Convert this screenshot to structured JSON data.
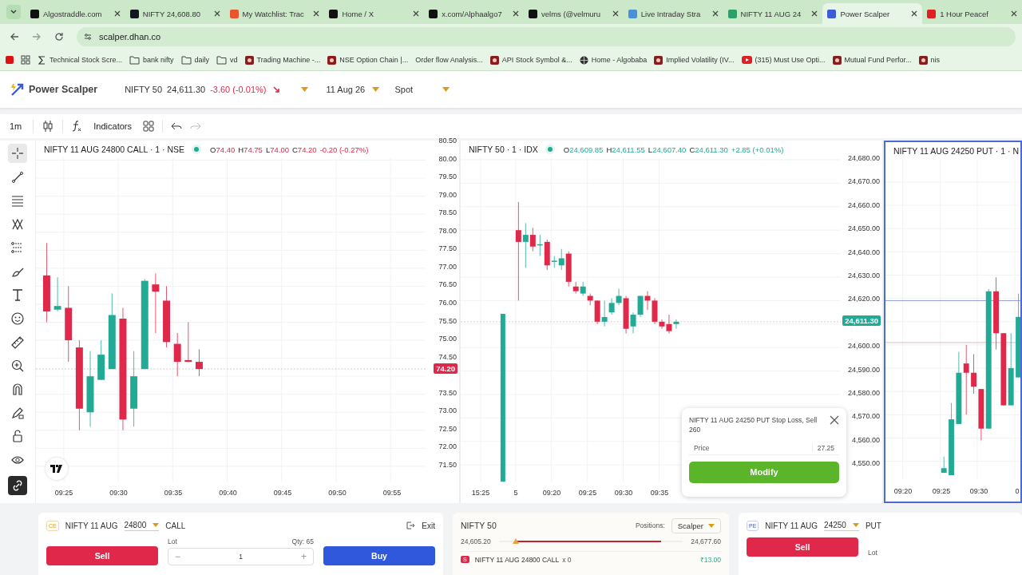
{
  "browser": {
    "tabs": [
      {
        "title": "Algostraddle.com",
        "color": "#111111",
        "selected": false
      },
      {
        "title": "NIFTY 24,608.80",
        "color": "#131722",
        "selected": false
      },
      {
        "title": "My Watchlist: Trac",
        "color": "#e8542f",
        "selected": false
      },
      {
        "title": "Home / X",
        "color": "#111111",
        "selected": false
      },
      {
        "title": "x.com/Alphaalgo7",
        "color": "#111111",
        "selected": false
      },
      {
        "title": "velms (@velmuru",
        "color": "#111111",
        "selected": false
      },
      {
        "title": "Live Intraday Stra",
        "color": "#4a90d9",
        "selected": false
      },
      {
        "title": "NIFTY 11 AUG 24",
        "color": "#2e9e6a",
        "selected": false
      },
      {
        "title": "Power Scalper",
        "color": "#3d5ad8",
        "selected": true
      },
      {
        "title": "1 Hour Peacef",
        "color": "#e02020",
        "selected": false
      }
    ],
    "url": "scalper.dhan.co",
    "bookmarks": [
      {
        "kind": "sigma",
        "label": "Technical Stock Scre..."
      },
      {
        "kind": "folder",
        "label": "bank nifty"
      },
      {
        "kind": "folder",
        "label": "daily"
      },
      {
        "kind": "folder",
        "label": "vd"
      },
      {
        "kind": "site",
        "label": "Trading Machine -..."
      },
      {
        "kind": "site",
        "label": "NSE Option Chain |..."
      },
      {
        "kind": "blank",
        "label": "Order flow Analysis..."
      },
      {
        "kind": "site",
        "label": "API Stock Symbol &..."
      },
      {
        "kind": "globe",
        "label": "Home - Algobaba"
      },
      {
        "kind": "site",
        "label": "Implied Volatility (IV..."
      },
      {
        "kind": "video",
        "label": "(315) Must Use Opti..."
      },
      {
        "kind": "site",
        "label": "Mutual Fund Perfor..."
      },
      {
        "kind": "site",
        "label": "nis"
      }
    ]
  },
  "app": {
    "name": "Power Scalper",
    "symbol": "NIFTY 50",
    "price": "24,611.30",
    "change": "-3.60 (-0.01%)",
    "falling": true,
    "expiry": "11 Aug 26",
    "mode": "Spot"
  },
  "toolbar": {
    "interval": "1m",
    "indicators": "Indicators",
    "undo": {
      "disabled": false
    },
    "redo": {
      "disabled": true
    }
  },
  "tools": [
    {
      "kind": "crosshair",
      "selected": true
    },
    {
      "kind": "trend-line",
      "selected": false
    },
    {
      "kind": "lines",
      "selected": false
    },
    {
      "kind": "pattern",
      "selected": false
    },
    {
      "kind": "fib",
      "selected": false
    },
    {
      "kind": "brush",
      "selected": false
    },
    {
      "kind": "text",
      "selected": false
    },
    {
      "kind": "smiley",
      "selected": false
    },
    {
      "kind": "ruler",
      "selected": false
    },
    {
      "kind": "zoom",
      "selected": false
    },
    {
      "kind": "magnet",
      "selected": false
    },
    {
      "kind": "pencil-lock",
      "selected": false
    },
    {
      "kind": "lock",
      "selected": false
    },
    {
      "kind": "eye",
      "selected": false
    },
    {
      "kind": "link",
      "selected": true
    }
  ],
  "charts": [
    {
      "title": "NIFTY 11 AUG 24800 CALL · 1 · NSE",
      "falling": true,
      "active": false,
      "ohlc": [
        {
          "label": "O",
          "value": "74.40"
        },
        {
          "label": "H",
          "value": "74.75"
        },
        {
          "label": "L",
          "value": "74.00"
        },
        {
          "label": "C",
          "value": "74.20"
        }
      ],
      "change": "-0.20 (-0.27%)",
      "y_labels": [
        "80.50",
        "80.00",
        "79.50",
        "79.00",
        "78.50",
        "78.00",
        "77.50",
        "77.00",
        "76.50",
        "76.00",
        "75.50",
        "75.00",
        "74.50",
        "73.50",
        "73.00",
        "72.50",
        "72.00",
        "71.50"
      ],
      "price_tag": "74.20",
      "x_labels": [
        "09:25",
        "09:30",
        "09:35",
        "09:40",
        "09:45",
        "09:50",
        "09:55"
      ]
    },
    {
      "title": "NIFTY 50 · 1 · IDX",
      "falling": false,
      "active": false,
      "ohlc": [
        {
          "label": "O",
          "value": "24,609.85"
        },
        {
          "label": "H",
          "value": "24,611.55"
        },
        {
          "label": "L",
          "value": "24,607.40"
        },
        {
          "label": "C",
          "value": "24,611.30"
        }
      ],
      "change": "+2.85 (+0.01%)",
      "y_labels": [
        "24,680.00",
        "24,670.00",
        "24,660.00",
        "24,650.00",
        "24,640.00",
        "24,630.00",
        "24,620.00",
        "24,600.00",
        "24,590.00",
        "24,580.00",
        "4,570.00",
        "4,560.00",
        "4,550.00"
      ],
      "price_tag": "24,611.30",
      "x_labels": [
        "15:25",
        "5",
        "09:20",
        "09:25",
        "09:30",
        "09:35"
      ]
    },
    {
      "title": "NIFTY 11 AUG 24250 PUT · 1 · N",
      "active": true,
      "x_labels": [
        "09:20",
        "09:25",
        "09:30",
        "0"
      ]
    }
  ],
  "popup": {
    "title": "NIFTY 11 AUG 24250 PUT Stop Loss, Sell 260",
    "field_label": "Price",
    "field_value": "27.25",
    "button": "Modify"
  },
  "order_panels": [
    {
      "badge": "CE",
      "symbol": "NIFTY 11 AUG",
      "strike": "24800",
      "type": "CALL",
      "exit": "Exit",
      "sell": "Sell",
      "lot_label": "Lot",
      "qty": "Qty: 65",
      "minus": "−",
      "lot": "1",
      "plus": "+",
      "buy": "Buy"
    },
    {
      "badge": "PE",
      "symbol": "NIFTY 11 AUG",
      "strike": "24250",
      "type": "PUT",
      "sell": "Sell",
      "lot_label": "Lot"
    }
  ],
  "positions": {
    "title": "NIFTY 50",
    "label": "Positions:",
    "strategy": "Scalper",
    "low": "24,605.20",
    "high": "24,677.60",
    "marker": {
      "level": 0.09
    },
    "row": {
      "badge": "S",
      "name": "NIFTY 11 AUG 24800 CALL",
      "qty": "x 0",
      "pnl": "₹13.00"
    }
  }
}
